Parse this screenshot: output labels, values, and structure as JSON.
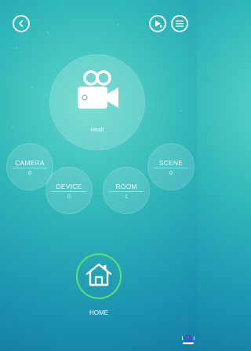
{
  "main": {
    "title": "Healt",
    "icon": "video-camera-icon"
  },
  "top_bar": {
    "back_icon": "back-chevron-icon",
    "play_icon": "play-icon",
    "menu_icon": "menu-icon"
  },
  "sections": [
    {
      "label": "CAMERA",
      "count": "0"
    },
    {
      "label": "DEVICE",
      "count": "0"
    },
    {
      "label": "ROOM",
      "count": "1"
    },
    {
      "label": "SCENE",
      "count": "0"
    }
  ],
  "home": {
    "label": "HOME",
    "icon": "home-icon",
    "ring_color": "#5fe071"
  },
  "alarm": {
    "icon": "alarm-icon",
    "color": "#2c5bd8"
  }
}
